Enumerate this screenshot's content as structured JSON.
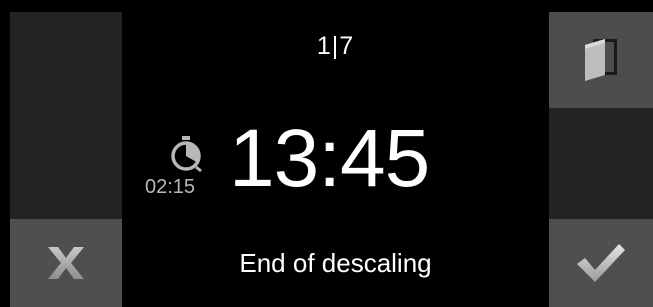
{
  "header": {
    "page_indicator": "1|7"
  },
  "timer": {
    "icon": "stopwatch-icon",
    "remaining": "02:15"
  },
  "clock": {
    "time": "13:45"
  },
  "status": {
    "message": "End of descaling"
  },
  "buttons": {
    "cancel_icon": "close-icon",
    "confirm_icon": "checkmark-icon",
    "door_icon": "door-icon"
  },
  "colors": {
    "background": "#000000",
    "panel_dark": "#232323",
    "panel_button": "#4f4f4f",
    "text_primary": "#ffffff",
    "text_secondary": "#b8b8b8"
  }
}
